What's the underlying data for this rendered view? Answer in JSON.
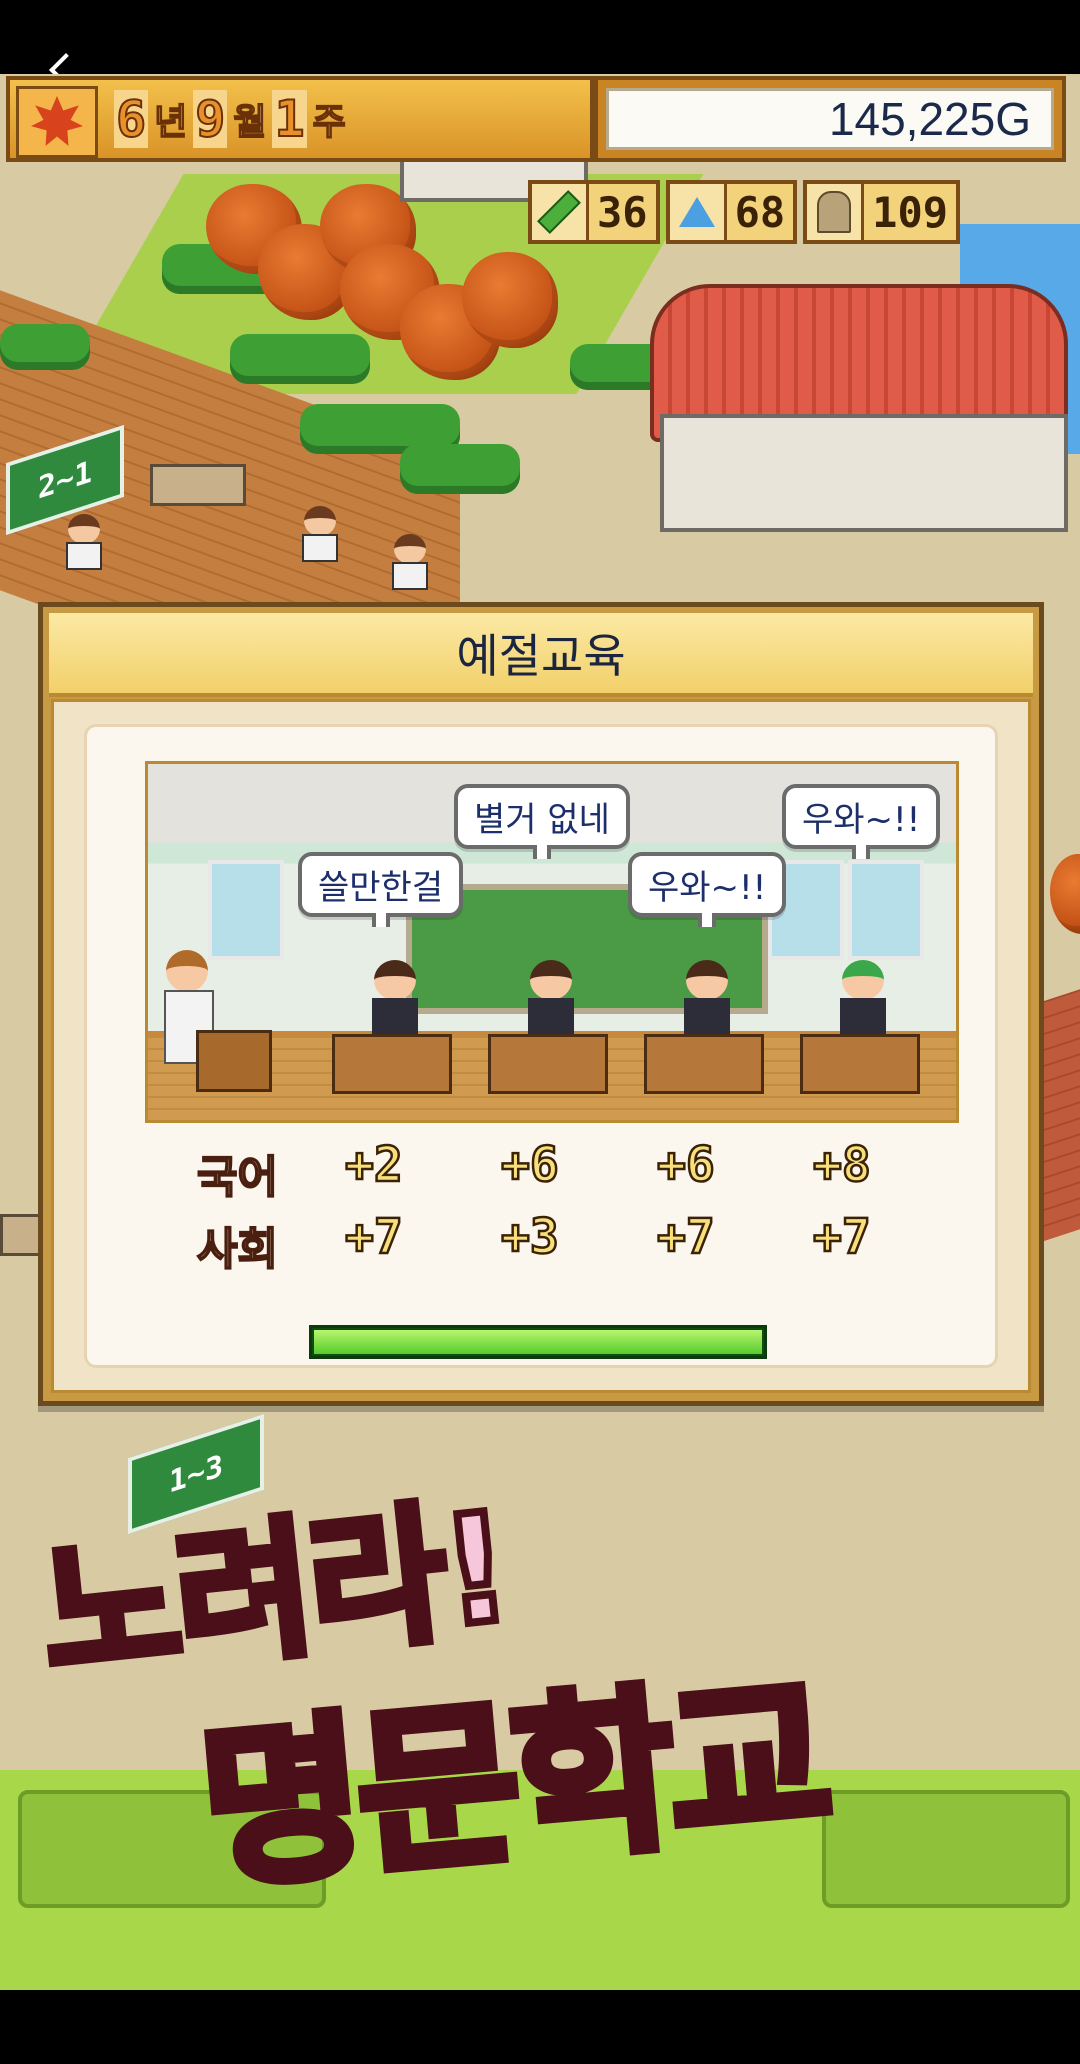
{
  "hud": {
    "date": {
      "year": "6",
      "year_unit": "년",
      "month": "9",
      "month_unit": "월",
      "week": "1",
      "week_unit": "주"
    },
    "money": "145,225G",
    "stats": [
      {
        "icon": "pencil-icon",
        "value": "36"
      },
      {
        "icon": "flask-icon",
        "value": "68"
      },
      {
        "icon": "bust-icon",
        "value": "109"
      }
    ]
  },
  "world": {
    "room_signs": [
      "2~1",
      "1~3"
    ]
  },
  "dialog": {
    "title": "예절교육",
    "bubbles": [
      "쓸만한걸",
      "별거 없네",
      "우와~!!",
      "우와~!!"
    ],
    "subjects": [
      "국어",
      "사회"
    ],
    "gains": {
      "row1": [
        "+2",
        "+6",
        "+6",
        "+8"
      ],
      "row2": [
        "+7",
        "+3",
        "+7",
        "+7"
      ]
    },
    "progress": 1.0
  },
  "logo": {
    "line1": "노려라!",
    "line2": "명문학교"
  },
  "colors": {
    "gold": "#f2d06a",
    "title_text": "#1b2540",
    "progress": "#55cc2c"
  }
}
